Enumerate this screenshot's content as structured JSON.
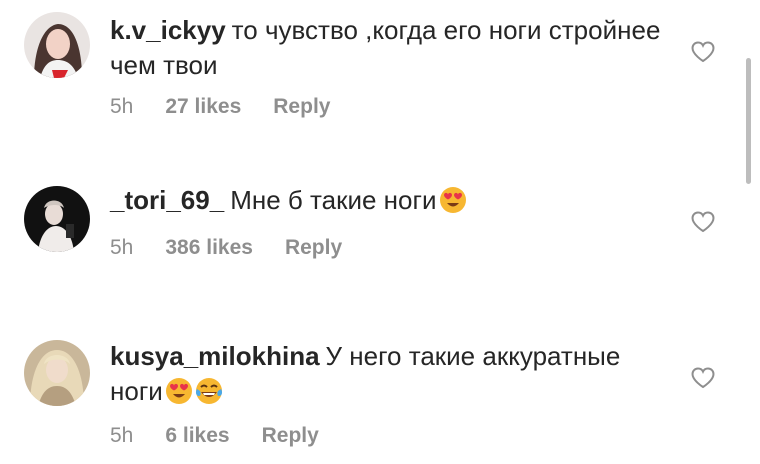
{
  "comments": [
    {
      "username": "k.v_ickyy",
      "text": "то чувство ,когда его ноги стройнее чем твои",
      "time": "5h",
      "likes": "27 likes",
      "reply": "Reply",
      "avatar_icon": "profile-photo-girl-dark-hair",
      "emojis": []
    },
    {
      "username": "_tori_69_",
      "text": "Мне б такие ноги",
      "time": "5h",
      "likes": "386 likes",
      "reply": "Reply",
      "avatar_icon": "profile-photo-dark-background",
      "emojis": [
        "heart-eyes-emoji"
      ]
    },
    {
      "username": "kusya_milokhina",
      "text": "У него такие аккуратные ноги",
      "time": "5h",
      "likes": "6 likes",
      "reply": "Reply",
      "avatar_icon": "profile-photo-blonde",
      "emojis": [
        "heart-eyes-emoji",
        "tears-of-joy-emoji"
      ]
    }
  ],
  "icons": {
    "like": "heart-outline-icon"
  },
  "colors": {
    "text": "#262626",
    "meta": "#8e8e8e",
    "emoji_yellow": "#f7b731",
    "emoji_heart": "#e8334a"
  }
}
